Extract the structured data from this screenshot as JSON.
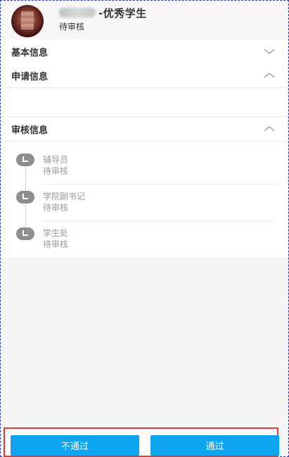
{
  "header": {
    "title_suffix": "-优秀学生",
    "status": "待审核"
  },
  "sections": {
    "basic": {
      "title": "基本信息",
      "state": "collapsed"
    },
    "apply": {
      "title": "申请信息",
      "state": "expanded"
    },
    "review": {
      "title": "审核信息",
      "state": "expanded"
    }
  },
  "timeline": [
    {
      "role": "辅导员",
      "status": "待审核"
    },
    {
      "role": "学院副书记",
      "status": "待审核"
    },
    {
      "role": "学生处",
      "status": "待审核"
    }
  ],
  "actions": {
    "reject_label": "不通过",
    "approve_label": "通过"
  },
  "colors": {
    "accent": "#0ea5ef",
    "highlight_border": "#e53935"
  }
}
